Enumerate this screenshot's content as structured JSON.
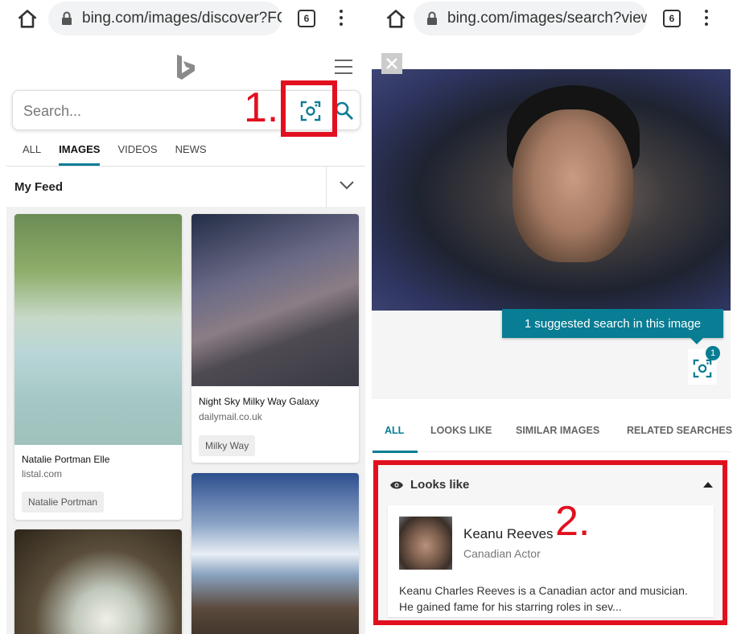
{
  "left": {
    "browser": {
      "url": "bing.com/images/discover?FC",
      "tab_count": "6"
    },
    "search": {
      "placeholder": "Search..."
    },
    "annotation": "1.",
    "scope_tabs": [
      "ALL",
      "IMAGES",
      "VIDEOS",
      "NEWS"
    ],
    "feed_title": "My Feed",
    "cards": [
      {
        "caption": "Natalie Portman Elle",
        "source": "listal.com",
        "tag": "Natalie Portman"
      },
      {
        "caption": "Night Sky Milky Way Galaxy",
        "source": "dailymail.co.uk",
        "tag": "Milky Way"
      }
    ]
  },
  "right": {
    "browser": {
      "url": "bing.com/images/search?view",
      "tab_count": "6"
    },
    "suggest_tooltip": "1 suggested search in this image",
    "badge_count": "1",
    "tabs": [
      "ALL",
      "LOOKS LIKE",
      "SIMILAR IMAGES",
      "RELATED SEARCHES"
    ],
    "looks_like": {
      "header": "Looks like",
      "name": "Keanu Reeves",
      "subtitle": "Canadian Actor",
      "description": "Keanu Charles Reeves is a Canadian actor and musician. He gained fame for his starring roles in sev..."
    },
    "annotation": "2."
  },
  "colors": {
    "accent": "#087d93",
    "highlight": "#e2101f"
  }
}
